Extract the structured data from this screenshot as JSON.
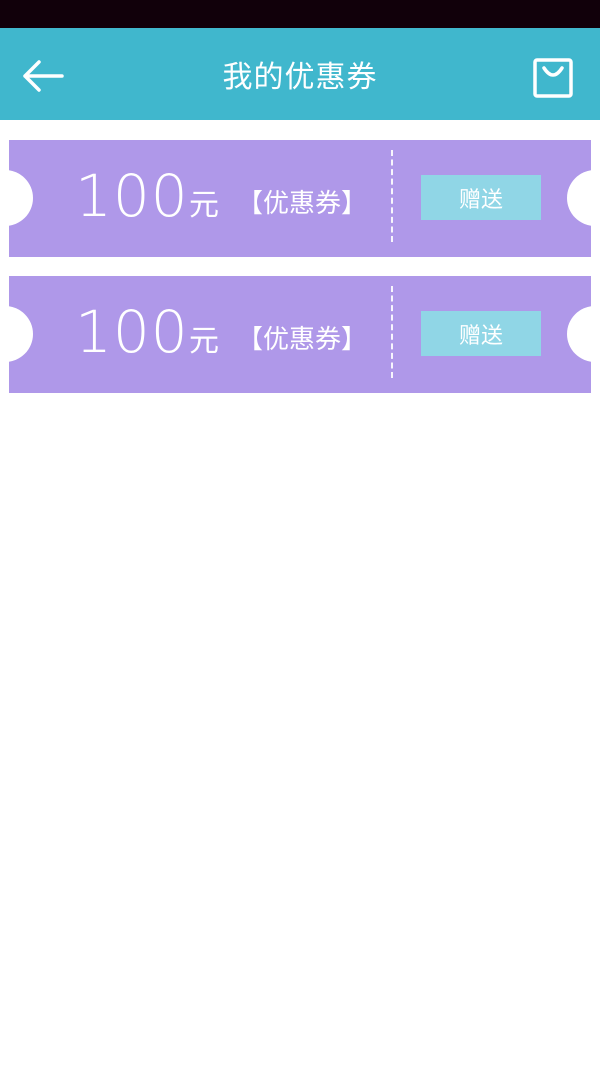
{
  "header": {
    "title": "我的优惠券",
    "back_icon": "arrow-left-icon",
    "bag_icon": "shopping-bag-icon"
  },
  "colors": {
    "status_bar": "#11000a",
    "header_bg": "#40b7cd",
    "coupon_bg": "#af98e9",
    "button_bg": "#90d6e6",
    "text": "#ffffff"
  },
  "coupons": [
    {
      "amount": "100",
      "unit": "元",
      "type_label": "【优惠券】",
      "action_label": "赠送"
    },
    {
      "amount": "100",
      "unit": "元",
      "type_label": "【优惠券】",
      "action_label": "赠送"
    }
  ]
}
